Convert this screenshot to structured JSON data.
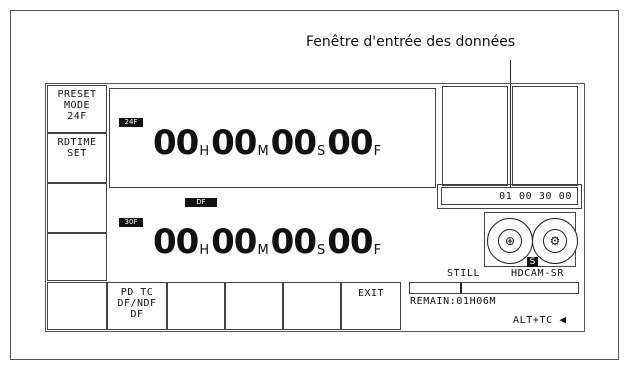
{
  "callout": {
    "label": "Fenêtre d'entrée des données"
  },
  "left_panel": {
    "preset_mode": [
      "PRESET",
      "MODE",
      "24F"
    ],
    "rdtime_set": [
      "RDTIME",
      "SET"
    ]
  },
  "timecode_top": {
    "badge": "24F",
    "hours": "00",
    "minutes": "00",
    "seconds": "00",
    "frames": "00",
    "unit_h": "H",
    "unit_m": "M",
    "unit_s": "S",
    "unit_f": "F"
  },
  "timecode_bottom": {
    "df_badge": "DF",
    "badge": "30F",
    "hours": "00",
    "minutes": "00",
    "seconds": "00",
    "frames": "00",
    "unit_h": "H",
    "unit_m": "M",
    "unit_s": "S",
    "unit_f": "F"
  },
  "data_entry": {
    "value": "01 00 30 00"
  },
  "tape_status": {
    "indicator": "S",
    "mode": "STILL",
    "format": "HDCAM-SR",
    "remaining": "REMAIN:01H06M",
    "alt_tc": "ALT+TC"
  },
  "remain_progress": 0.3,
  "icons": {
    "reel_left": "reel-plus-icon",
    "reel_right": "reel-gear-icon",
    "arrow": "arrow-left-icon"
  },
  "function_keys": {
    "pd_tc": [
      "PD TC",
      "DF/NDF",
      "DF"
    ],
    "exit": "EXIT"
  }
}
